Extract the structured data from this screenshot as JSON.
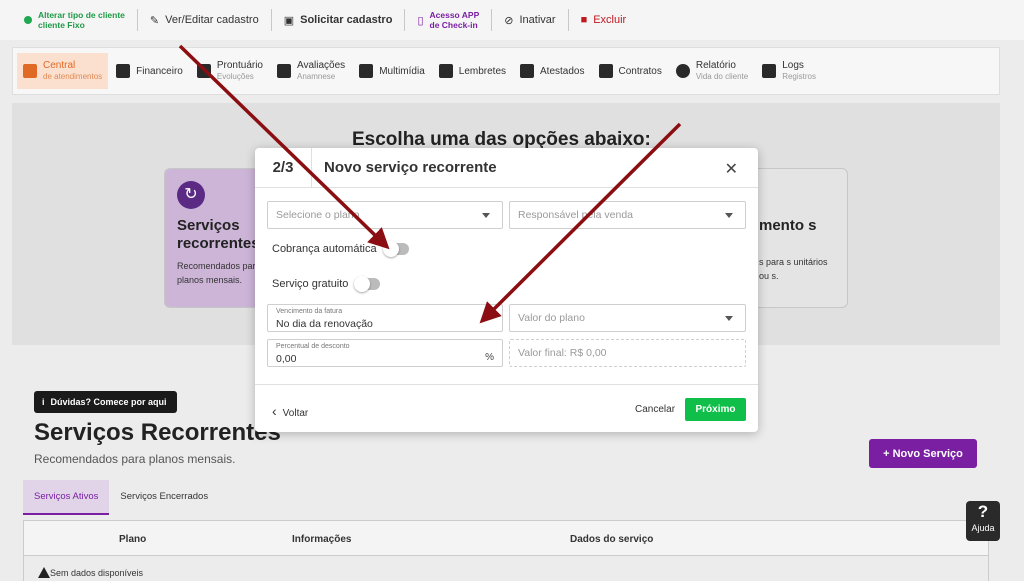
{
  "toolbar": {
    "change_type_line1": "Alterar tipo de cliente",
    "change_type_line2": "cliente Fixo",
    "edit": "Ver/Editar cadastro",
    "request": "Solicitar cadastro",
    "app_line1": "Acesso APP",
    "app_line2": "de Check-in",
    "deactivate": "Inativar",
    "delete": "Excluir"
  },
  "nav": {
    "central": "Central",
    "central_sub": "de atendimentos",
    "financeiro": "Financeiro",
    "prontuario": "Prontuário",
    "prontuario_sub": "Evoluções",
    "avaliacoes": "Avaliações",
    "avaliacoes_sub": "Anamnese",
    "multimidia": "Multimídia",
    "lembretes": "Lembretes",
    "atestados": "Atestados",
    "contratos": "Contratos",
    "relatorio": "Relatório",
    "relatorio_sub": "Vida do cliente",
    "logs": "Logs",
    "logs_sub": "Registros"
  },
  "panel": {
    "title": "Escolha uma das opções abaixo:",
    "card1_title": "Serviços recorrentes",
    "card1_desc": "Recomendados para planos mensais.",
    "card2_title": "mento s",
    "card2_desc": "s para s unitários ou s."
  },
  "lower": {
    "help_badge": "Dúvidas? Comece por aqui",
    "title": "Serviços Recorrentes",
    "subtitle": "Recomendados para planos mensais.",
    "new_button": "+ Novo Serviço",
    "tab_active": "Serviços Ativos",
    "tab_closed": "Serviços Encerrados",
    "col_plano": "Plano",
    "col_info": "Informações",
    "col_dados": "Dados do serviço",
    "empty": "Sem dados disponíveis"
  },
  "ajuda": "Ajuda",
  "modal": {
    "step": "2/3",
    "title": "Novo serviço recorrente",
    "plan_placeholder": "Selecione o plano",
    "seller_placeholder": "Responsável pela venda",
    "auto_charge": "Cobrança automática",
    "free_service": "Serviço gratuito",
    "due_label": "Vencimento da fatura",
    "due_value": "No dia da renovação",
    "plan_value_placeholder": "Valor do plano",
    "discount_label": "Percentual de desconto",
    "discount_value": "0,00",
    "discount_suffix": "%",
    "final_value": "Valor final: R$ 0,00",
    "back": "Voltar",
    "cancel": "Cancelar",
    "next": "Próximo"
  },
  "colors": {
    "accent_purple": "#7a1fa2",
    "accent_orange": "#e06a25",
    "next_green": "#0fbf4a",
    "arrow_red": "#8b0f12"
  }
}
